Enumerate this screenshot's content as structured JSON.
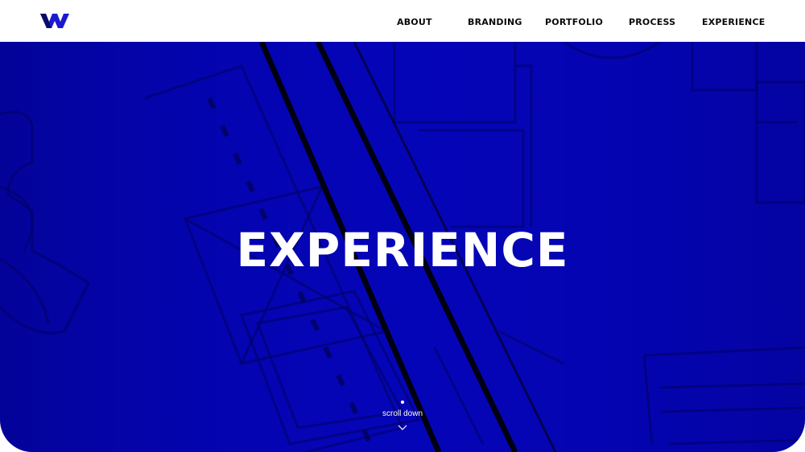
{
  "brand": {
    "accent": "#0505b8",
    "logo_alt": "W logo"
  },
  "nav": {
    "items": [
      {
        "label": "ABOUT"
      },
      {
        "label": "BRANDING"
      },
      {
        "label": "PORTFOLIO"
      },
      {
        "label": "PROCESS"
      },
      {
        "label": "EXPERIENCE"
      }
    ]
  },
  "hero": {
    "title": "EXPERIENCE",
    "scroll_label": "scroll down"
  },
  "icons": {
    "logo": "w-logo-icon",
    "scroll": "chevron-down-icon"
  }
}
